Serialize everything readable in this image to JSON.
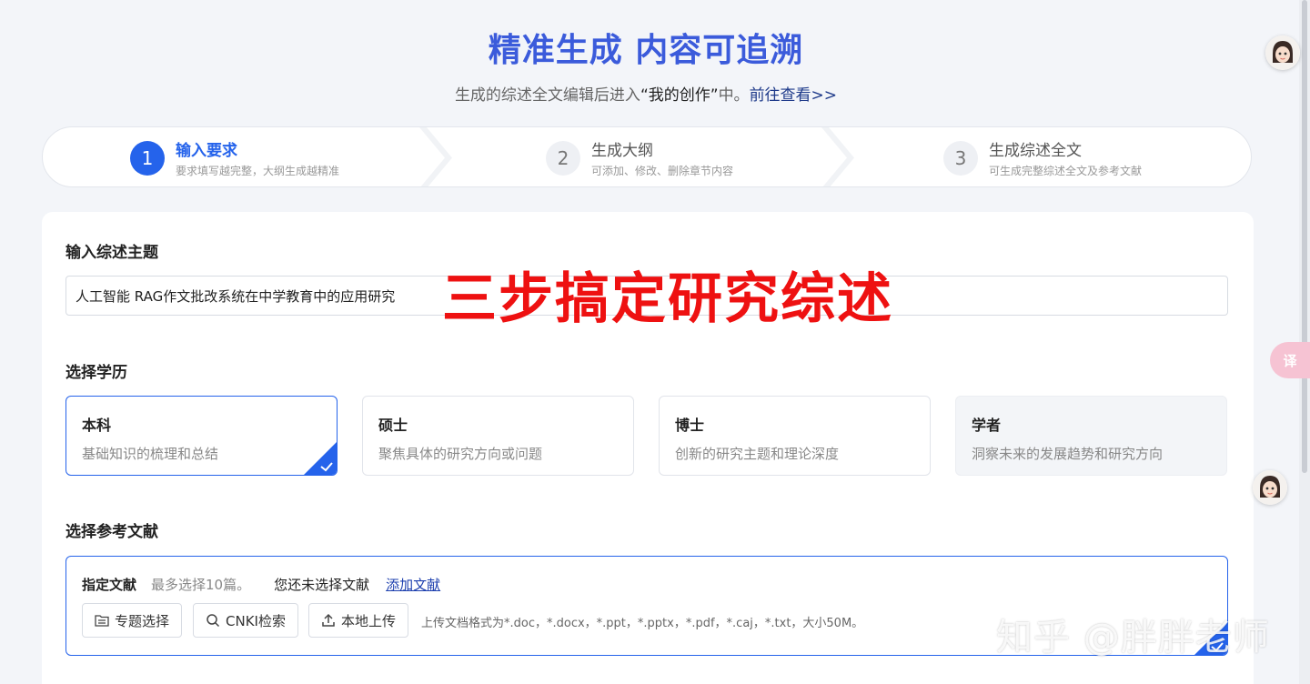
{
  "hero": {
    "title": "精准生成  内容可追溯",
    "subtitle_pre": "生成的综述全文编辑后进入",
    "subtitle_em": "“我的创作”",
    "subtitle_mid": "中。",
    "subtitle_link": "前往查看>>"
  },
  "steps": [
    {
      "num": "1",
      "title": "输入要求",
      "desc": "要求填写越完整，大纲生成越精准",
      "active": true
    },
    {
      "num": "2",
      "title": "生成大纲",
      "desc": "可添加、修改、删除章节内容",
      "active": false
    },
    {
      "num": "3",
      "title": "生成综述全文",
      "desc": "可生成完整综述全文及参考文献",
      "active": false
    }
  ],
  "topic": {
    "label": "输入综述主题",
    "value": "人工智能 RAG作文批改系统在中学教育中的应用研究"
  },
  "overlay_text": "三步搞定研究综述",
  "education": {
    "label": "选择学历",
    "options": [
      {
        "title": "本科",
        "desc": "基础知识的梳理和总结",
        "selected": true
      },
      {
        "title": "硕士",
        "desc": "聚焦具体的研究方向或问题",
        "selected": false
      },
      {
        "title": "博士",
        "desc": "创新的研究主题和理论深度",
        "selected": false
      },
      {
        "title": "学者",
        "desc": "洞察未来的发展趋势和研究方向",
        "selected": false
      }
    ]
  },
  "references": {
    "label": "选择参考文献",
    "tab_label": "指定文献",
    "limit_text": "最多选择10篇。",
    "none_text": "您还未选择文献",
    "add_link": "添加文献",
    "buttons": {
      "topic": "专题选择",
      "cnki": "CNKI检索",
      "upload": "本地上传"
    },
    "hint": "上传文档格式为*.doc，*.docx，*.ppt，*.pptx，*.pdf，*.caj，*.txt，大小50M。"
  },
  "translate_label": "译",
  "watermark": "知乎 @胖胖老师",
  "colors": {
    "accent": "#2563eb",
    "title": "#3b5bdb",
    "overlay": "#ee1111"
  }
}
